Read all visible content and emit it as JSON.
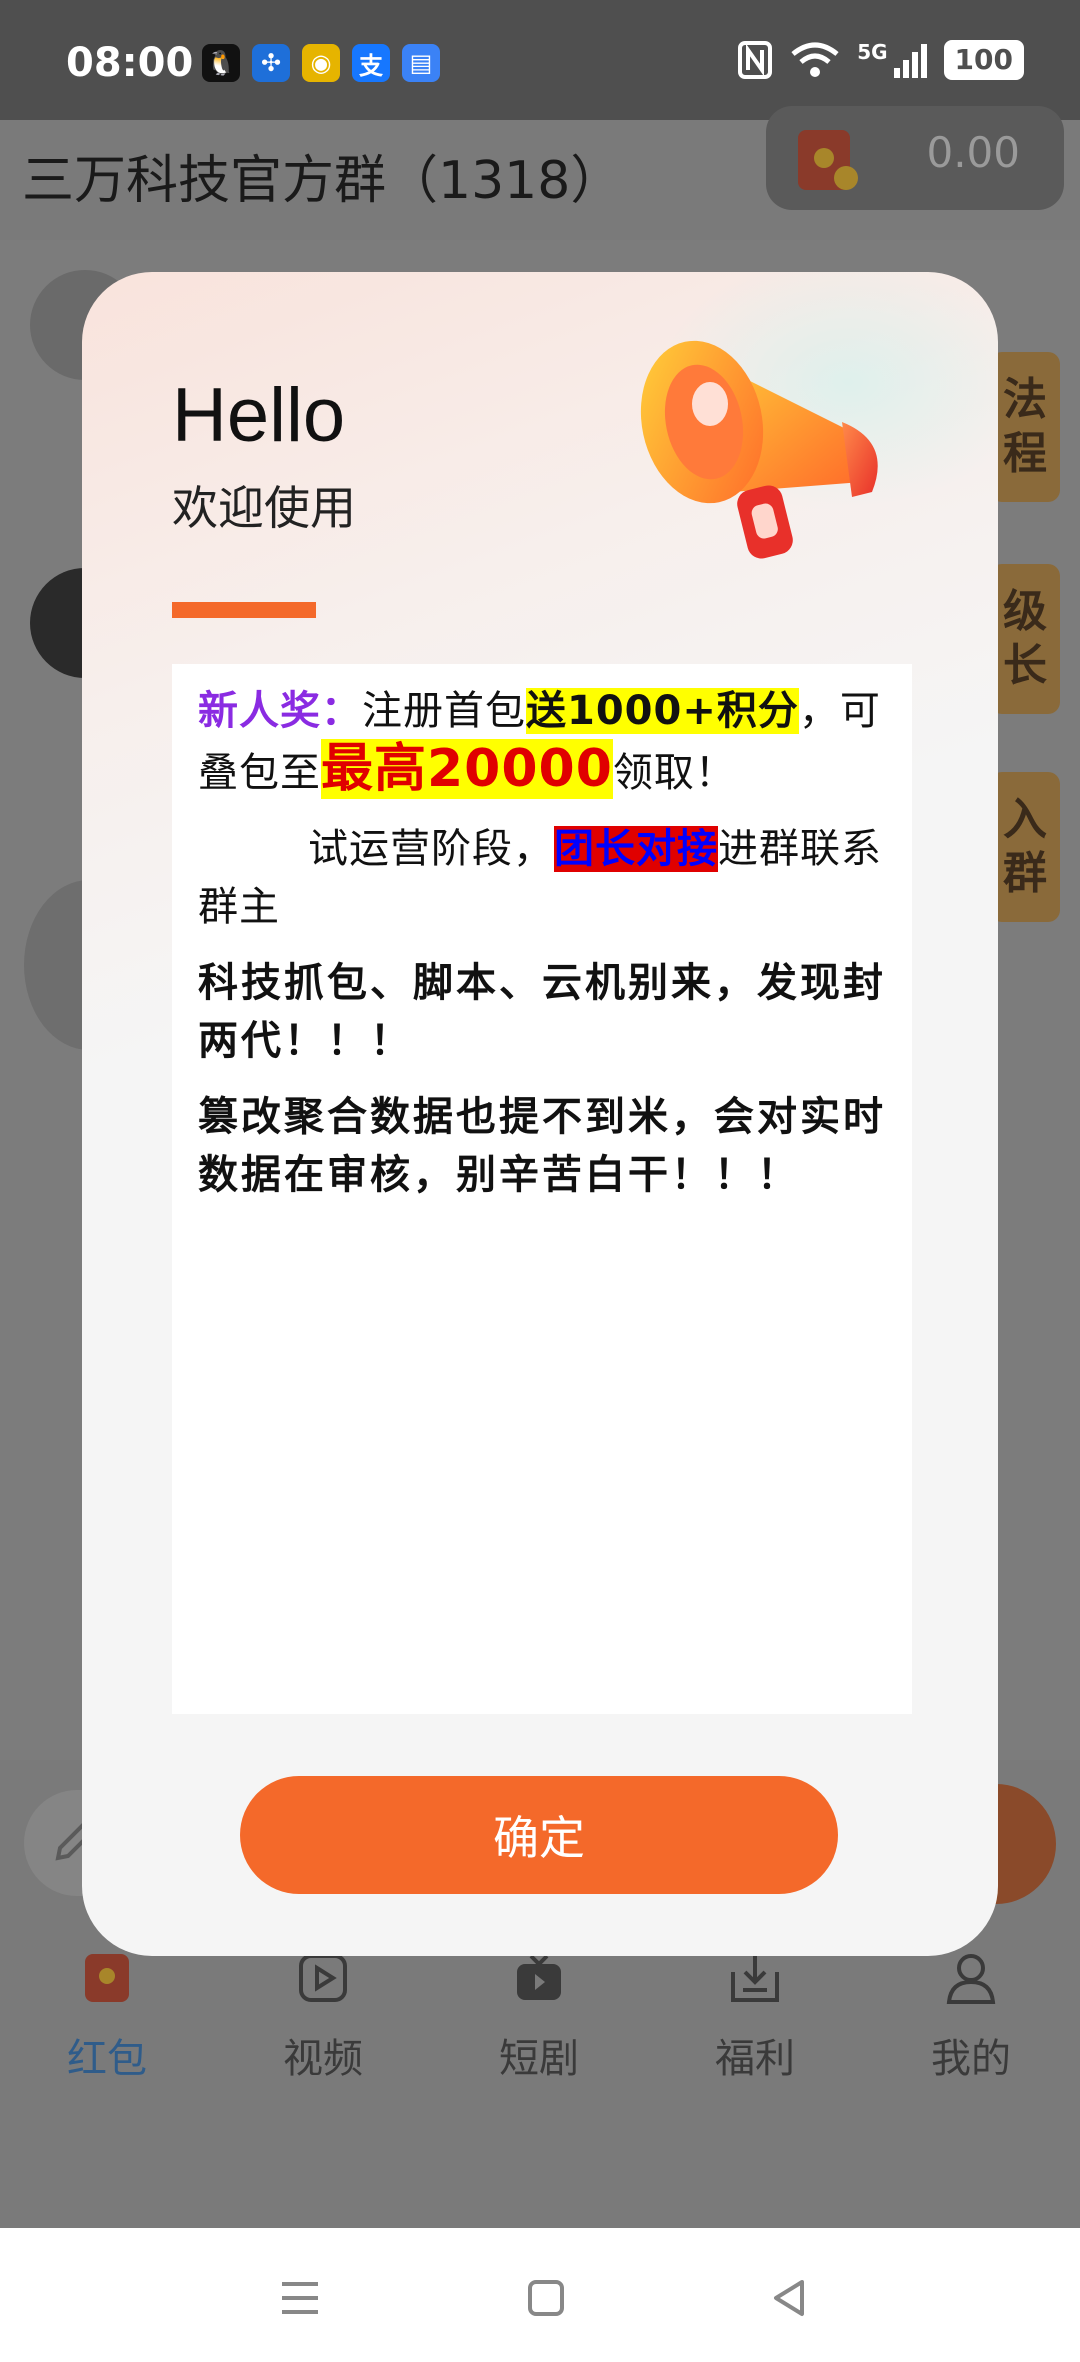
{
  "status_bar": {
    "time": "08:00",
    "apps": [
      {
        "icon": "qq-icon",
        "glyph": "🐧",
        "color": "#111111"
      },
      {
        "icon": "pinwheel-icon",
        "glyph": "✣",
        "color": "#1e6fd9"
      },
      {
        "icon": "weibo-icon",
        "glyph": "◉",
        "color": "#e6b400"
      },
      {
        "icon": "alipay-icon",
        "glyph": "支",
        "color": "#1677ff"
      },
      {
        "icon": "doc-icon",
        "glyph": "▤",
        "color": "#3b82f6"
      }
    ],
    "signal": "5G",
    "battery": "100"
  },
  "header": {
    "group_title": "三万科技官方群（1318）",
    "balance": "0.00"
  },
  "side_badges": [
    {
      "text": "法\n程"
    },
    {
      "text": "级\n长"
    },
    {
      "text": "入\n群"
    }
  ],
  "modal": {
    "greeting": "Hello",
    "subtitle": "欢迎使用",
    "p1_label": "新人奖：",
    "p1_a": "注册首包",
    "p1_highlight": "送1000+积分",
    "p1_b": "，可叠包至",
    "p1_big": "最高20000",
    "p1_c": "领取！",
    "p2_a": "试运营阶段，",
    "p2_highlight": "团长对接",
    "p2_b": "进群联系群主",
    "p3": "科技抓包、脚本、云机别来，发现封两代！！！",
    "p4": "篡改聚合数据也提不到米，会对实时数据在审核，别辛苦白干！！！",
    "confirm_label": "确定"
  },
  "tabs": [
    {
      "label": "红包",
      "icon": "red-packet-icon",
      "active": true
    },
    {
      "label": "视频",
      "icon": "video-icon",
      "active": false
    },
    {
      "label": "短剧",
      "icon": "tv-icon",
      "active": false
    },
    {
      "label": "福利",
      "icon": "gift-box-icon",
      "active": false
    },
    {
      "label": "我的",
      "icon": "user-icon",
      "active": false
    }
  ],
  "colors": {
    "accent": "#f4692a",
    "active_tab": "#2f5c8a"
  }
}
